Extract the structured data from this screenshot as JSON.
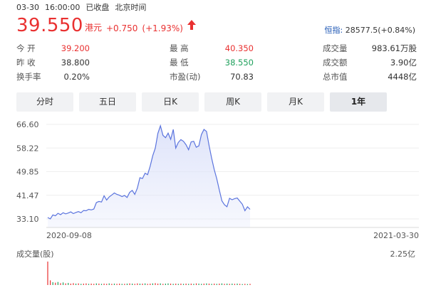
{
  "header": {
    "date": "03-30",
    "time": "16:00:00",
    "status": "已收盘",
    "timezone": "北京时间"
  },
  "quote": {
    "price": "39.550",
    "currency": "港元",
    "change": "+0.750",
    "change_pct": "(+1.93%)",
    "direction_icon": "arrow-up-icon"
  },
  "index": {
    "name": "恒指:",
    "value": "28577.5(+0.84%)"
  },
  "stats": [
    [
      {
        "label": "今  开",
        "value": "39.200",
        "color": "red"
      },
      {
        "label": "最  高",
        "value": "40.350",
        "color": "red"
      },
      {
        "label": "成交量",
        "value": "983.61万股",
        "color": "plain"
      }
    ],
    [
      {
        "label": "昨  收",
        "value": "38.800",
        "color": "plain"
      },
      {
        "label": "最  低",
        "value": "38.550",
        "color": "green"
      },
      {
        "label": "成交额",
        "value": "3.90亿",
        "color": "plain"
      }
    ],
    [
      {
        "label": "换手率",
        "value": "0.20%",
        "color": "plain"
      },
      {
        "label": "市盈(动)",
        "value": "70.83",
        "color": "plain"
      },
      {
        "label": "总市值",
        "value": "4448亿",
        "color": "plain"
      }
    ]
  ],
  "tabs": [
    {
      "label": "分时",
      "active": false
    },
    {
      "label": "五日",
      "active": false
    },
    {
      "label": "日K",
      "active": false
    },
    {
      "label": "周K",
      "active": false
    },
    {
      "label": "月K",
      "active": false
    },
    {
      "label": "1年",
      "active": true
    }
  ],
  "colors": {
    "up": "#e93030",
    "down": "#1fa05c",
    "line": "#5b74de",
    "fill": "#dfe4fa",
    "link": "#1a54b3"
  },
  "chart_data": {
    "type": "area",
    "y_ticks": [
      "66.60",
      "58.22",
      "49.85",
      "41.47",
      "33.10"
    ],
    "ylim": [
      33.1,
      66.6
    ],
    "x_start_label": "2020-09-08",
    "x_end_label": "2021-03-30",
    "volume_label": "成交量(股)",
    "volume_max_label": "2.25亿",
    "price_series": [
      33.6,
      33.1,
      34.5,
      34.2,
      35.1,
      34.6,
      35.3,
      34.9,
      35.2,
      35.6,
      35.0,
      35.4,
      35.7,
      35.3,
      36.1,
      36.0,
      36.5,
      36.3,
      36.6,
      38.9,
      39.3,
      39.1,
      41.3,
      39.8,
      40.9,
      41.6,
      42.3,
      41.8,
      41.5,
      41.0,
      41.4,
      40.7,
      42.5,
      43.2,
      41.8,
      44.0,
      47.7,
      47.4,
      49.3,
      48.8,
      51.8,
      55.5,
      58.2,
      63.4,
      66.1,
      62.7,
      61.9,
      63.5,
      61.3,
      64.8,
      58.2,
      60.2,
      61.2,
      60.6,
      59.4,
      57.6,
      60.4,
      60.6,
      58.5,
      59.0,
      63.0,
      64.8,
      64.1,
      59.1,
      54.6,
      50.6,
      47.3,
      43.3,
      39.5,
      38.1,
      37.4,
      40.4,
      39.9,
      40.3,
      40.5,
      39.4,
      38.3,
      36.0,
      37.4,
      36.5
    ],
    "volume_series": [
      1.0,
      0.2,
      0.12,
      0.1,
      0.13,
      0.08,
      0.11,
      0.07,
      0.09,
      0.06,
      0.08,
      0.06,
      0.07,
      0.05,
      0.06,
      0.07,
      0.05,
      0.06,
      0.05,
      0.07,
      0.06,
      0.05,
      0.06,
      0.05,
      0.07,
      0.05,
      0.06,
      0.05,
      0.06,
      0.05,
      0.05,
      0.06,
      0.07,
      0.06,
      0.05,
      0.07,
      0.06,
      0.06,
      0.07,
      0.05,
      0.06,
      0.07,
      0.08,
      0.06,
      0.07,
      0.05,
      0.06,
      0.07,
      0.06,
      0.05,
      0.06,
      0.05,
      0.06,
      0.05,
      0.06,
      0.05,
      0.06,
      0.05,
      0.07,
      0.06,
      0.05,
      0.06,
      0.07,
      0.06,
      0.05,
      0.06,
      0.05,
      0.06,
      0.07,
      0.05,
      0.06,
      0.05,
      0.06,
      0.05,
      0.06,
      0.05,
      0.04,
      0.05,
      0.04,
      0.05
    ],
    "volume_up": [
      true,
      true,
      false,
      true,
      false,
      true,
      false,
      true,
      false,
      true,
      true,
      false,
      true,
      false,
      true,
      true,
      false,
      true,
      true,
      false,
      true,
      false,
      true,
      true,
      false,
      true,
      false,
      true,
      true,
      false,
      true,
      false,
      true,
      false,
      true,
      true,
      false,
      true,
      false,
      true,
      true,
      false,
      true,
      true,
      false,
      true,
      false,
      false,
      true,
      false,
      true,
      false,
      true,
      false,
      true,
      false,
      true,
      false,
      true,
      false,
      false,
      true,
      false,
      true,
      false,
      true,
      false,
      true,
      false,
      true,
      false,
      true,
      false,
      true,
      false,
      true,
      false,
      true,
      false,
      true
    ]
  }
}
